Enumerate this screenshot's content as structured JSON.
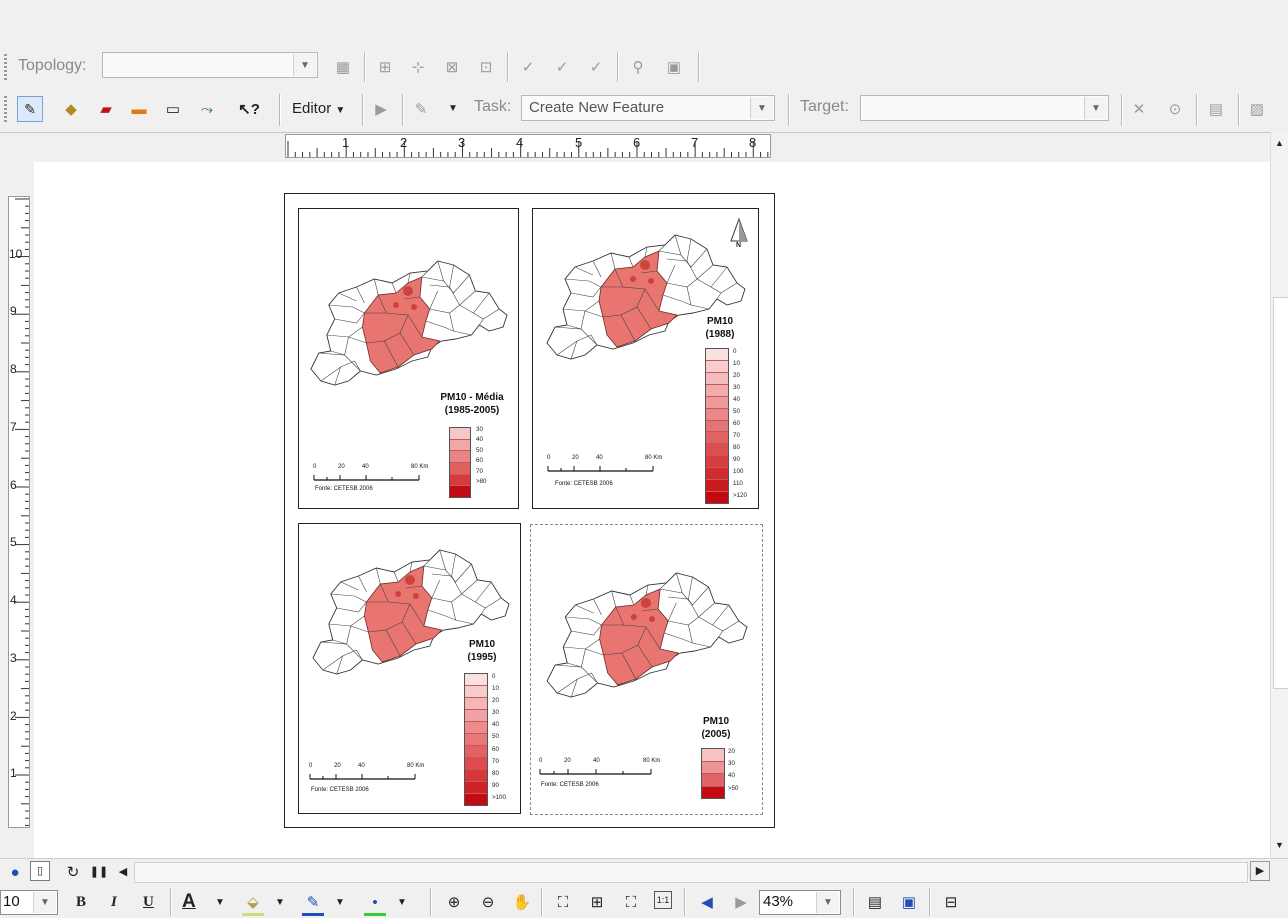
{
  "toolbar_topology": {
    "label": "Topology:",
    "layer_value": ""
  },
  "toolbar_editor": {
    "editor_menu": "Editor",
    "task_label": "Task:",
    "task_value": "Create New Feature",
    "target_label": "Target:",
    "target_value": ""
  },
  "ruler": {
    "horizontal": [
      "1",
      "2",
      "3",
      "4",
      "5",
      "6",
      "7",
      "8"
    ],
    "vertical": [
      "10",
      "9",
      "8",
      "7",
      "6",
      "5",
      "4",
      "3",
      "2",
      "1"
    ]
  },
  "maps": [
    {
      "title": "PM10 - Média\n(1985-2005)",
      "legend": [
        "30",
        "40",
        "50",
        "60",
        "70",
        ">80"
      ],
      "colors": [
        "#f6c7c9",
        "#f0a7a8",
        "#e88585",
        "#e06060",
        "#d63a3c",
        "#c40a14"
      ],
      "scale": [
        "0",
        "20",
        "40",
        "80 Km"
      ],
      "source": "Fonte: CETESB 2006"
    },
    {
      "title": "PM10\n(1988)",
      "legend": [
        "0",
        "10",
        "20",
        "30",
        "40",
        "50",
        "60",
        "70",
        "80",
        "90",
        "100",
        "110",
        ">120"
      ],
      "colors": [
        "#fbe0e0",
        "#f8cdce",
        "#f5bcbd",
        "#f2abac",
        "#ee999a",
        "#ea8788",
        "#e57475",
        "#e16263",
        "#dc4f51",
        "#d63d3f",
        "#d02b2e",
        "#c91a1e",
        "#c20810"
      ],
      "scale": [
        "0",
        "20",
        "40",
        "80 Km"
      ],
      "source": "Fonte: CETESB 2006"
    },
    {
      "title": "PM10\n(1995)",
      "legend": [
        "0",
        "10",
        "20",
        "30",
        "40",
        "50",
        "60",
        "70",
        "80",
        "90",
        ">100"
      ],
      "colors": [
        "#fbe0e0",
        "#f8cbcc",
        "#f4b6b7",
        "#f0a1a2",
        "#ec8c8d",
        "#e77778",
        "#e26263",
        "#dc4c4e",
        "#d63739",
        "#cf2226",
        "#c40a14"
      ],
      "scale": [
        "0",
        "20",
        "40",
        "80 Km"
      ],
      "source": "Fonte: CETESB 2006"
    },
    {
      "title": "PM10\n(2005)",
      "legend": [
        "20",
        "30",
        "40",
        ">50"
      ],
      "colors": [
        "#f6c3c5",
        "#ec9596",
        "#e06465",
        "#c40a14"
      ],
      "scale": [
        "0",
        "20",
        "40",
        "80 Km"
      ],
      "source": "Fonte: CETESB 2006"
    }
  ],
  "north_arrow": "N",
  "bottom_toolbar": {
    "font_size": "10",
    "bold": "B",
    "italic": "I",
    "underline": "U",
    "font_color": "A",
    "zoom_value": "43%"
  },
  "colors": {
    "map_fill": "#e8756f",
    "map_dark": "#c93a35",
    "accent_red": "#d01818",
    "nav_blue": "#1f4fb6"
  }
}
